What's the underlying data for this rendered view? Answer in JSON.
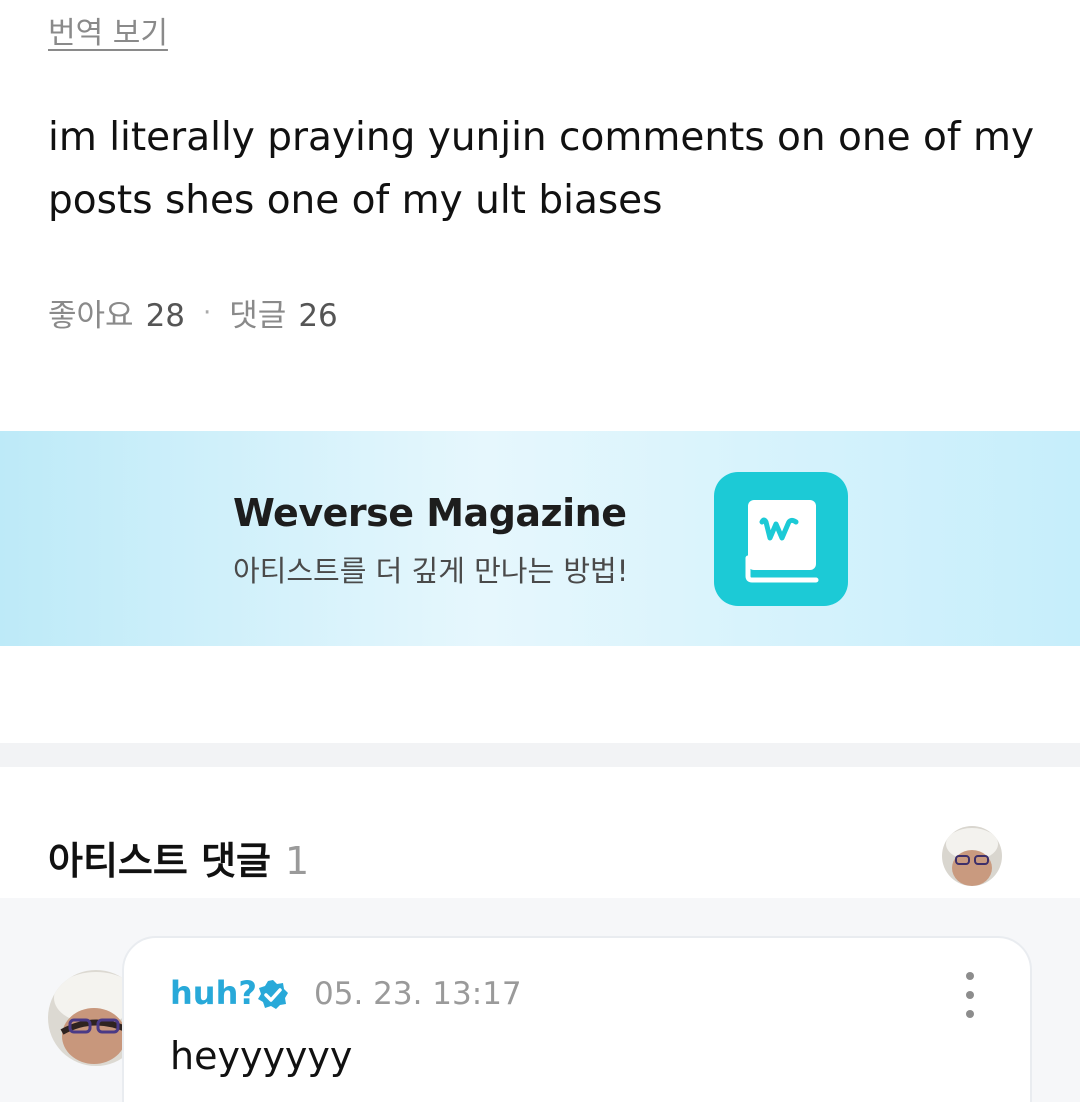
{
  "post": {
    "translate_label": "번역 보기",
    "body": "im literally praying yunjin comments on one of my posts shes one of my ult biases",
    "likes_label": "좋아요",
    "likes_count": "28",
    "separator": "·",
    "comments_label": "댓글",
    "comments_count": "26"
  },
  "banner": {
    "title": "Weverse Magazine",
    "subtitle": "아티스트를 더 깊게 만나는 방법!",
    "icon": "weverse-magazine-book-icon",
    "icon_color": "#1ccad6"
  },
  "artist_comments": {
    "header_label": "아티스트 댓글",
    "count": "1",
    "comments": [
      {
        "author": "huh?",
        "verified": true,
        "timestamp": "05. 23. 13:17",
        "text": "heyyyyyy"
      }
    ]
  },
  "colors": {
    "accent": "#28a9d9",
    "muted_text": "#8a8a8a"
  }
}
